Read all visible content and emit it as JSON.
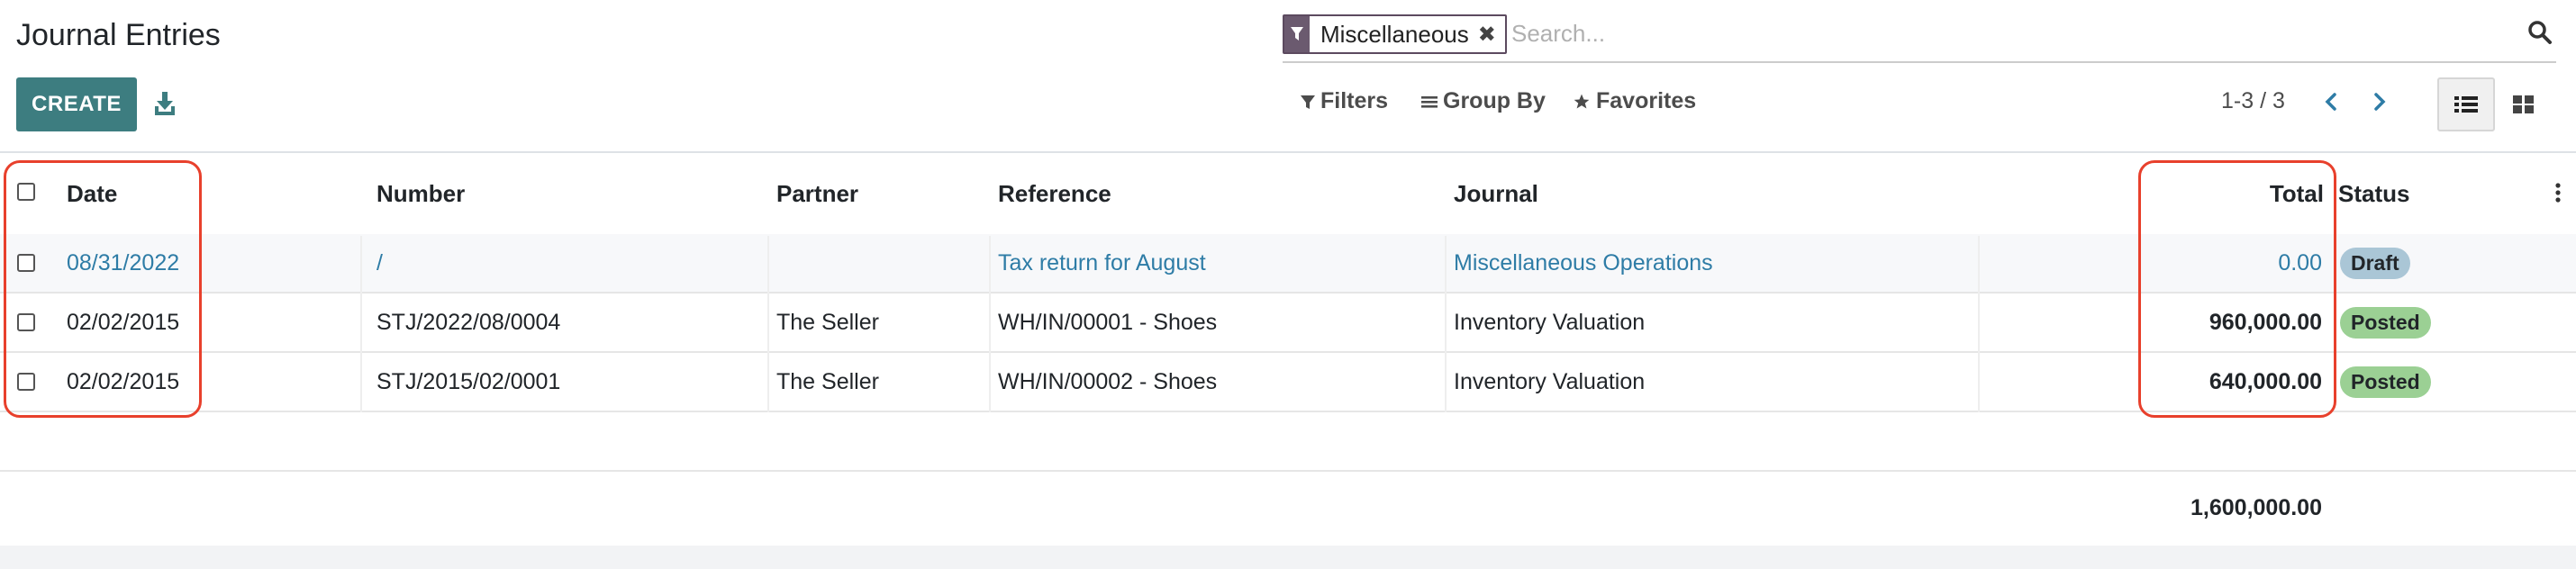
{
  "page": {
    "title": "Journal Entries"
  },
  "toolbar": {
    "create_label": "CREATE",
    "download_icon": "download-icon"
  },
  "search": {
    "facet_label": "Miscellaneous",
    "facet_icon": "filter-icon",
    "facet_remove": "✖",
    "placeholder": "Search..."
  },
  "controls": {
    "filters_label": "Filters",
    "groupby_label": "Group By",
    "favorites_label": "Favorites",
    "pager": "1-3 / 3"
  },
  "table": {
    "columns": {
      "date": "Date",
      "number": "Number",
      "partner": "Partner",
      "reference": "Reference",
      "journal": "Journal",
      "total": "Total",
      "status": "Status"
    },
    "rows": [
      {
        "date": "08/31/2022",
        "number": "/",
        "partner": "",
        "reference": "Tax return for August",
        "journal": "Miscellaneous Operations",
        "total": "0.00",
        "status": "Draft"
      },
      {
        "date": "02/02/2015",
        "number": "STJ/2022/08/0004",
        "partner": "The Seller",
        "reference": "WH/IN/00001 - Shoes",
        "journal": "Inventory Valuation",
        "total": "960,000.00",
        "status": "Posted"
      },
      {
        "date": "02/02/2015",
        "number": "STJ/2015/02/0001",
        "partner": "The Seller",
        "reference": "WH/IN/00002 - Shoes",
        "journal": "Inventory Valuation",
        "total": "640,000.00",
        "status": "Posted"
      }
    ],
    "grand_total": "1,600,000.00"
  },
  "colors": {
    "primary": "#3d7d80",
    "link": "#2e7ca6",
    "draft_badge": "#aac6d6",
    "posted_badge": "#9bd094",
    "highlight": "#e8402c"
  }
}
